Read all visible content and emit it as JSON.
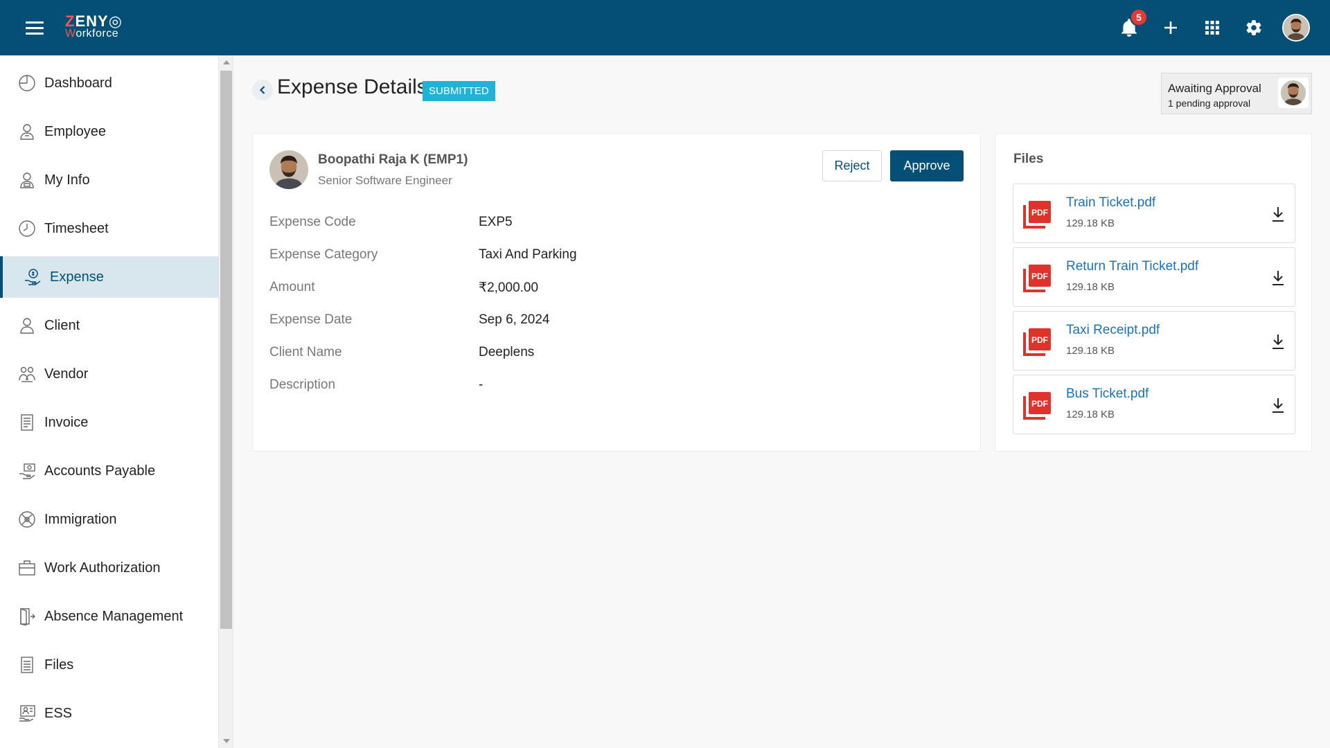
{
  "header": {
    "logo_top": "ZENYO",
    "logo_bottom": "Workforce",
    "notification_count": "5"
  },
  "sidebar": {
    "items": [
      {
        "label": "Dashboard",
        "icon": "dashboard-icon"
      },
      {
        "label": "Employee",
        "icon": "employee-icon"
      },
      {
        "label": "My Info",
        "icon": "my-info-icon"
      },
      {
        "label": "Timesheet",
        "icon": "clock-icon"
      },
      {
        "label": "Expense",
        "icon": "expense-icon",
        "active": true
      },
      {
        "label": "Client",
        "icon": "client-icon"
      },
      {
        "label": "Vendor",
        "icon": "vendor-icon"
      },
      {
        "label": "Invoice",
        "icon": "invoice-icon"
      },
      {
        "label": "Accounts Payable",
        "icon": "accounts-payable-icon"
      },
      {
        "label": "Immigration",
        "icon": "globe-icon"
      },
      {
        "label": "Work Authorization",
        "icon": "briefcase-icon"
      },
      {
        "label": "Absence Management",
        "icon": "door-exit-icon"
      },
      {
        "label": "Files",
        "icon": "file-icon"
      },
      {
        "label": "ESS",
        "icon": "ess-icon"
      }
    ]
  },
  "page": {
    "title": "Expense Details",
    "status": "SUBMITTED"
  },
  "approval": {
    "title": "Awaiting Approval",
    "subtitle": "1 pending approval"
  },
  "employee": {
    "name": "Boopathi Raja K (EMP1)",
    "role": "Senior Software Engineer"
  },
  "actions": {
    "reject": "Reject",
    "approve": "Approve"
  },
  "details": [
    {
      "label": "Expense Code",
      "value": "EXP5"
    },
    {
      "label": "Expense Category",
      "value": "Taxi And Parking"
    },
    {
      "label": "Amount",
      "value": "₹2,000.00"
    },
    {
      "label": "Expense Date",
      "value": "Sep 6, 2024"
    },
    {
      "label": "Client Name",
      "value": "Deeplens"
    },
    {
      "label": "Description",
      "value": "-"
    }
  ],
  "files": {
    "title": "Files",
    "items": [
      {
        "name": "Train Ticket.pdf",
        "size": "129.18 KB"
      },
      {
        "name": "Return Train Ticket.pdf",
        "size": "129.18 KB"
      },
      {
        "name": "Taxi Receipt.pdf",
        "size": "129.18 KB"
      },
      {
        "name": "Bus Ticket.pdf",
        "size": "129.18 KB"
      }
    ]
  },
  "colors": {
    "brand": "#034f75",
    "accent": "#f05a4a",
    "status_badge": "#1eb3d7",
    "link": "#1a73b8",
    "notification": "#e53935"
  }
}
